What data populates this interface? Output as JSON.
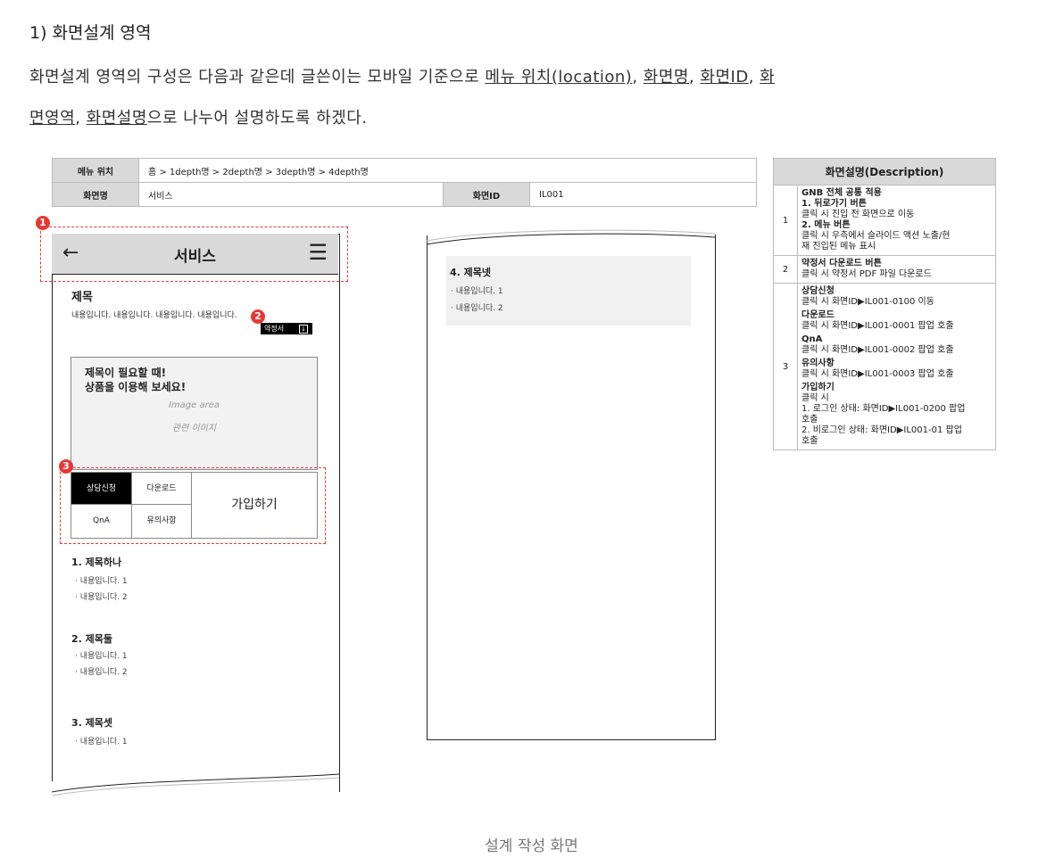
{
  "heading": "1) 화면설계 영역",
  "intro": {
    "t1": "화면설계 영역의 구성은 다음과 같은데 글쓴이는 모바일 기준으로 ",
    "l1": "메뉴 위치(location)",
    "s1": ", ",
    "l2": "화면명",
    "s2": ", ",
    "l3": "화면ID",
    "s3": ", ",
    "l4a": "화",
    "l4b": "면영역",
    "s4": ", ",
    "l5": "화면설명",
    "t2": "으로 나누어 설명하도록 하겠다."
  },
  "info_table": {
    "menu_label": "메뉴 위치",
    "menu_value": "홈 > 1depth명 > 2depth명 > 3depth명 > 4depth명",
    "name_label": "화면명",
    "name_value": "서비스",
    "id_label": "화면ID",
    "id_value": "IL001"
  },
  "screen": {
    "back_icon": "←",
    "title": "서비스",
    "menu_icon": "☰",
    "subject": "제목",
    "desc": "내용입니다. 내용입니다. 내용입니다. 내용입니다.",
    "pdf_label": "약정서",
    "pdf_icon": "↓",
    "image_line1": "제목이 필요할 때!",
    "image_line2": "상품을 이용해 보세요!",
    "image_area": "Image area",
    "image_related": "관련 이미지",
    "btn_consult": "상담신청",
    "btn_download": "다운로드",
    "btn_join": "가입하기",
    "btn_qna": "QnA",
    "btn_notice": "유의사항",
    "sections": [
      {
        "title": "1. 제목하나",
        "items": [
          "내용입니다. 1",
          "내용입니다. 2"
        ]
      },
      {
        "title": "2. 제목둘",
        "items": [
          "내용입니다. 1",
          "내용입니다. 2"
        ]
      },
      {
        "title": "3. 제목셋",
        "items": [
          "내용입니다. 1"
        ]
      }
    ],
    "section4": {
      "title": "4. 제목넷",
      "items": [
        "내용입니다. 1",
        "내용입니다. 2"
      ]
    }
  },
  "badges": [
    "1",
    "2",
    "3"
  ],
  "desc_table": {
    "header": "화면설명(Description)",
    "rows": [
      {
        "num": "1",
        "lines": [
          "GNB 전체 공통 적용",
          "1. 뒤로가기 버튼",
          "클릭 시 진입 전 화면으로 이동",
          "2. 메뉴 버튼",
          "클릭 시 우측에서 슬라이드 액션 노출/현",
          "재 진입된 메뉴 표시"
        ]
      },
      {
        "num": "2",
        "lines": [
          "약정서 다운로드 버튼",
          "클릭 시 약정서 PDF 파일 다운로드"
        ]
      },
      {
        "num": "3",
        "lines": [
          "상담신청",
          "클릭 시 화면ID▶IL001-0100 이동",
          "다운로드",
          "클릭 시 화면ID▶IL001-0001 팝업 호출",
          "QnA",
          "클릭 시 화면ID▶IL001-0002 팝업 호출",
          "유의사항",
          "클릭 시 화면ID▶IL001-0003 팝업 호출",
          "가입하기",
          "클릭 시",
          "1. 로그인 상태: 화면ID▶IL001-0200 팝업",
          "호출",
          "2. 비로그인 상태: 화면ID▶IL001-01 팝업",
          "호출"
        ]
      }
    ]
  },
  "caption": "설계 작성 화면"
}
